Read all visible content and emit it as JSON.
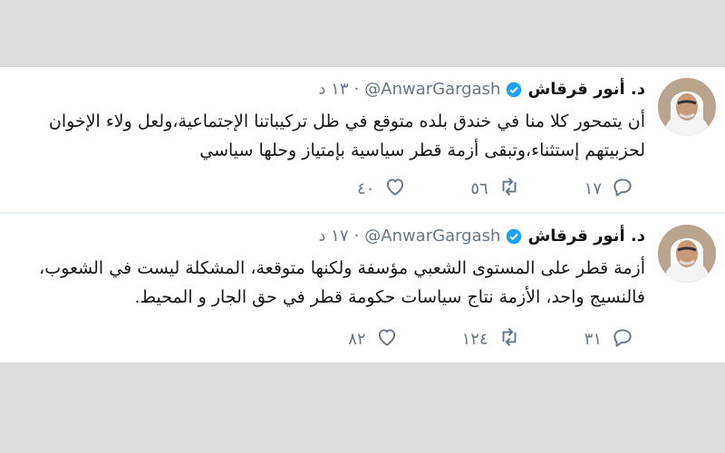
{
  "tweets": [
    {
      "name": "د. أنور قرقاش",
      "handle": "@AnwarGargash",
      "time": "١٣ د",
      "text": "أن يتمحور كلا منا في خندق بلده متوقع في ظل تركيباتنا الإجتماعية،ولعل ولاء الإخوان لحزبيتهم إستثناء،وتبقى أزمة قطر سياسية بإمتياز وحلها سياسي",
      "replies": "١٧",
      "retweets": "٥٦",
      "likes": "٤٠",
      "icons": {
        "reply": "reply-icon",
        "retweet": "retweet-icon",
        "like": "heart-icon",
        "verified": "verified-badge-icon"
      }
    },
    {
      "name": "د. أنور قرقاش",
      "handle": "@AnwarGargash",
      "time": "١٧ د",
      "text": "أزمة قطر على المستوى الشعبي مؤسفة ولكنها متوقعة، المشكلة ليست في الشعوب، فالنسيج واحد، الأزمة نتاج سياسات حكومة قطر في حق الجار و المحيط.",
      "replies": "٣١",
      "retweets": "١٢٤",
      "likes": "٨٢",
      "icons": {
        "reply": "reply-icon",
        "retweet": "retweet-icon",
        "like": "heart-icon",
        "verified": "verified-badge-icon"
      }
    }
  ],
  "colors": {
    "background": "#dcdcdc",
    "card": "#ffffff",
    "text": "#14171a",
    "muted": "#657786",
    "verified": "#1da1f2"
  }
}
